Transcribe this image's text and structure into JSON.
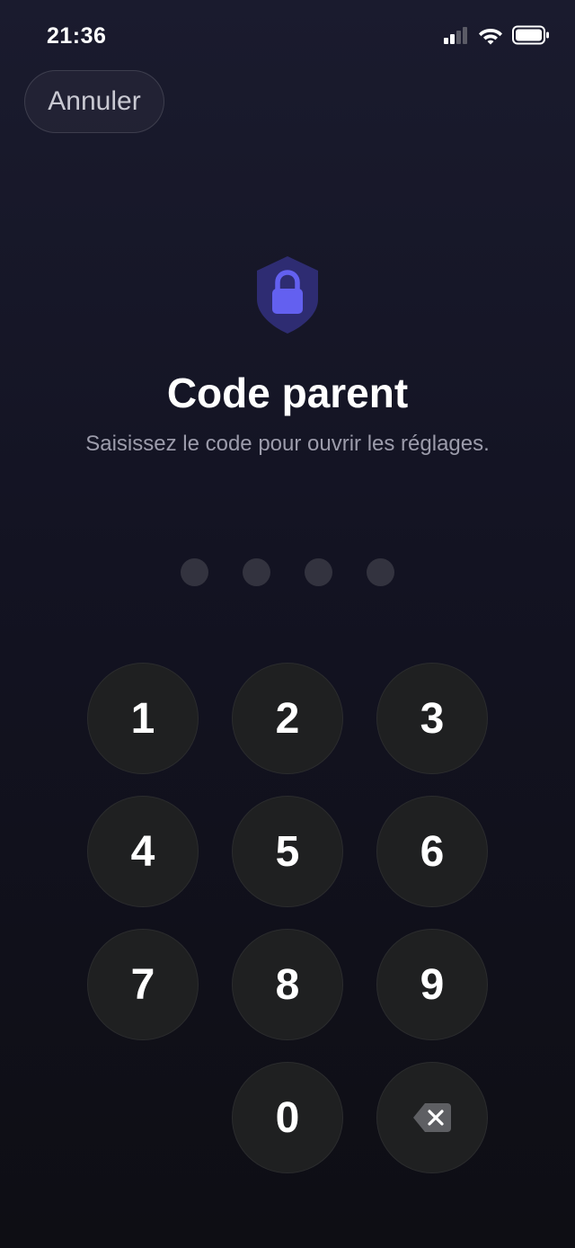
{
  "status_bar": {
    "time": "21:36",
    "icons": [
      "cellular-signal-icon",
      "wifi-icon",
      "battery-icon"
    ]
  },
  "header": {
    "cancel_label": "Annuler"
  },
  "lock": {
    "icon": "shield-lock-icon",
    "title": "Code parent",
    "subtitle": "Saisissez le code pour ouvrir les réglages."
  },
  "pin": {
    "length": 4,
    "filled": 0
  },
  "keypad": {
    "keys": [
      "1",
      "2",
      "3",
      "4",
      "5",
      "6",
      "7",
      "8",
      "9",
      "0"
    ],
    "delete_icon": "backspace-icon"
  },
  "colors": {
    "accent": "#6360f0",
    "shield": "#2e2c72",
    "background_top": "#1a1b2e",
    "background_bottom": "#0e0e14"
  }
}
